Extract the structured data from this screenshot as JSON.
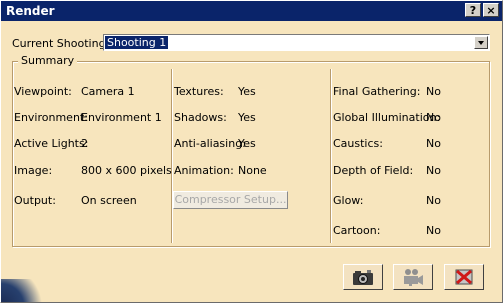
{
  "window": {
    "title": "Render"
  },
  "titlebar": {
    "help_label": "?",
    "close_label": "×"
  },
  "shooting": {
    "label": "Current Shooting:",
    "value": "Shooting 1"
  },
  "summary": {
    "legend": "Summary",
    "col1": [
      {
        "label": "Viewpoint:",
        "value": "Camera  1"
      },
      {
        "label": "Environment:",
        "value": "Environment 1"
      },
      {
        "label": "Active Lights:",
        "value": "2"
      },
      {
        "label": "Image:",
        "value": "800 x 600 pixels"
      },
      {
        "label": "Output:",
        "value": "On screen"
      }
    ],
    "col2": [
      {
        "label": "Textures:",
        "value": "Yes"
      },
      {
        "label": "Shadows:",
        "value": "Yes"
      },
      {
        "label": "Anti-aliasing:",
        "value": "Yes"
      },
      {
        "label": "Animation:",
        "value": "None"
      }
    ],
    "compressor_label": "Compressor Setup...",
    "col3": [
      {
        "label": "Final Gathering:",
        "value": "No"
      },
      {
        "label": "Global Illumination:",
        "value": "No"
      },
      {
        "label": "Caustics:",
        "value": "No"
      },
      {
        "label": "Depth of Field:",
        "value": "No"
      },
      {
        "label": "Glow:",
        "value": "No"
      },
      {
        "label": "Cartoon:",
        "value": "No"
      }
    ]
  },
  "actions": {
    "buttons": [
      {
        "icon": "camera-icon"
      },
      {
        "icon": "movie-camera-icon"
      },
      {
        "icon": "close-render-icon"
      }
    ]
  },
  "colors": {
    "titlebar": "#0a246a",
    "background": "#f7e5bd",
    "selection": "#0a246a"
  }
}
